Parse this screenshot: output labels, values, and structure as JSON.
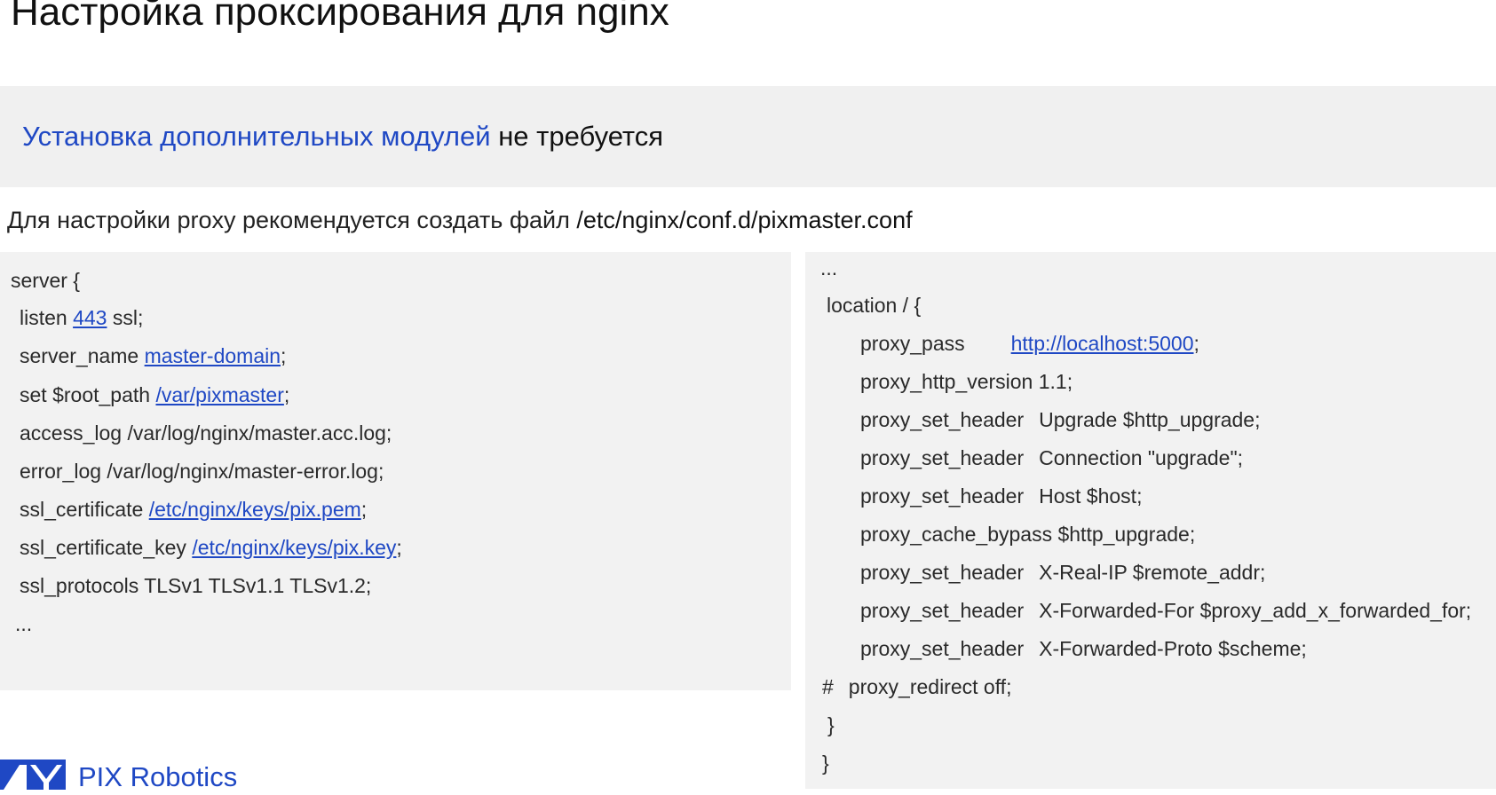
{
  "page": {
    "title": "Настройка проксирования для nginx"
  },
  "note": {
    "highlight": "Установка дополнительных модулей",
    "rest": " не требуется"
  },
  "intro": {
    "text": "Для настройки proxy рекомендуется создать файл ",
    "path": "/etc/nginx/conf.d/pixmaster.conf"
  },
  "left_config": {
    "line1": "server {",
    "line2_prefix": "listen ",
    "line2_link": "443",
    "line2_suffix": " ssl;",
    "line3_prefix": "server_name ",
    "line3_link": "master-domain",
    "line3_suffix": ";",
    "line4_prefix": "set $root_path ",
    "line4_link": "/var/pixmaster",
    "line4_suffix": ";",
    "line5": "access_log /var/log/nginx/master.acc.log;",
    "line6": "error_log /var/log/nginx/master-error.log;",
    "line7_prefix": "ssl_certificate ",
    "line7_link": "/etc/nginx/keys/pix.pem",
    "line7_suffix": ";",
    "line8_prefix": "ssl_certificate_key ",
    "line8_link": "/etc/nginx/keys/pix.key",
    "line8_suffix": ";",
    "line9": "ssl_protocols TLSv1 TLSv1.1 TLSv1.2;",
    "line10": "..."
  },
  "right_config": {
    "line1": "...",
    "line2": "location / {",
    "line3_key": "proxy_pass",
    "line3_link": "http://localhost:5000",
    "line3_suffix": ";",
    "line4": "proxy_http_version 1.1;",
    "line5_key": "proxy_set_header",
    "line5_value": "Upgrade $http_upgrade;",
    "line6_key": "proxy_set_header",
    "line6_value": "Connection \"upgrade\";",
    "line7_key": "proxy_set_header",
    "line7_value": "Host $host;",
    "line8": "proxy_cache_bypass $http_upgrade;",
    "line9_key": "proxy_set_header",
    "line9_value": "X-Real-IP $remote_addr;",
    "line10_key": "proxy_set_header",
    "line10_value": "X-Forwarded-For $proxy_add_x_forwarded_for;",
    "line11_key": "proxy_set_header",
    "line11_value": "X-Forwarded-Proto $scheme;",
    "line12_hash": "#",
    "line12_text": "proxy_redirect off;",
    "line13": "}",
    "line14": "}"
  },
  "logo": {
    "text": "PIX Robotics",
    "icon": "pix-robotics-logo-icon",
    "color": "#1f48c4"
  },
  "colors": {
    "accent": "#1f48c4",
    "panel_background": "#f2f2f2",
    "banner_background": "#f0f0f0"
  }
}
